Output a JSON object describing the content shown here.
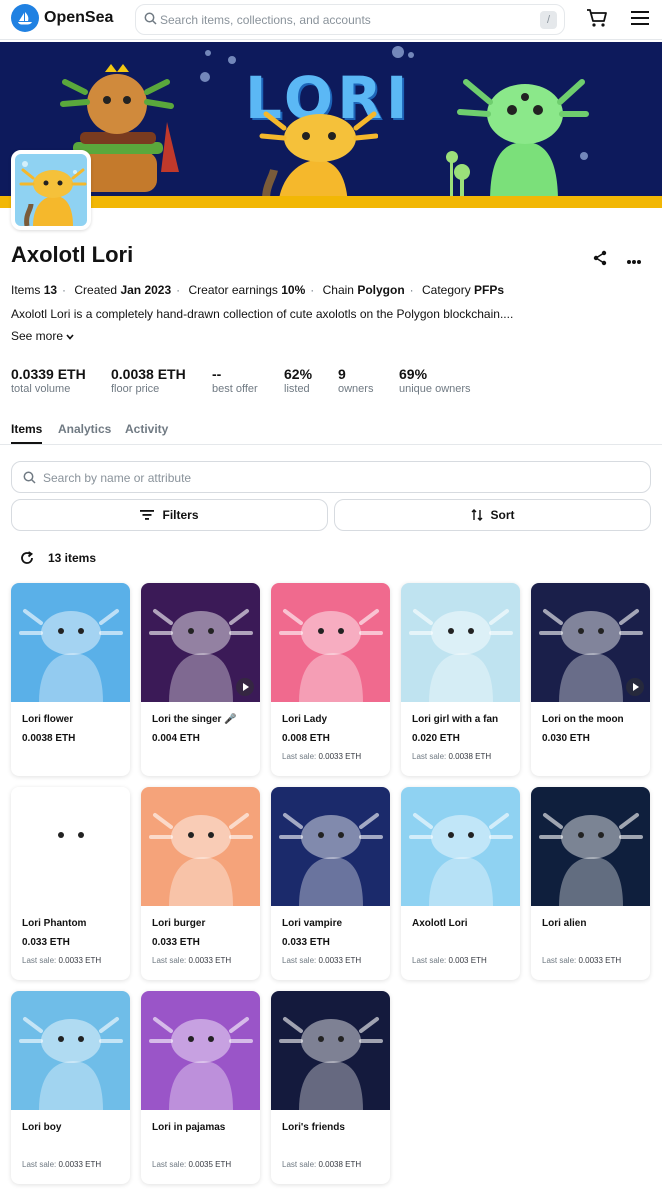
{
  "header": {
    "brand": "OpenSea",
    "search_placeholder": "Search items, collections, and accounts",
    "search_shortcut": "/",
    "icons": [
      "opensea-logo-icon",
      "search-icon",
      "cart-icon",
      "menu-icon"
    ]
  },
  "banner": {
    "title": "LORI"
  },
  "collection": {
    "title": "Axolotl Lori",
    "meta": {
      "items_label": "Items",
      "items_value": "13",
      "created_label": "Created",
      "created_value": "Jan 2023",
      "earnings_label": "Creator earnings",
      "earnings_value": "10%",
      "chain_label": "Chain",
      "chain_value": "Polygon",
      "category_label": "Category",
      "category_value": "PFPs"
    },
    "description": "Axolotl Lori is a completely hand-drawn collection of cute axolotls on the Polygon blockchain....",
    "see_more": "See more"
  },
  "stats": [
    {
      "value": "0.0339 ETH",
      "label": "total volume"
    },
    {
      "value": "0.0038 ETH",
      "label": "floor price"
    },
    {
      "value": "--",
      "label": "best offer"
    },
    {
      "value": "62%",
      "label": "listed"
    },
    {
      "value": "9",
      "label": "owners"
    },
    {
      "value": "69%",
      "label": "unique owners"
    }
  ],
  "tabs": [
    {
      "label": "Items",
      "active": true
    },
    {
      "label": "Analytics",
      "active": false
    },
    {
      "label": "Activity",
      "active": false
    }
  ],
  "filters": {
    "search_placeholder": "Search by name or attribute",
    "filters_label": "Filters",
    "sort_label": "Sort",
    "count": "13 items"
  },
  "colors": {
    "accent": "#2081e2",
    "banner_bg": "#0d1a5c",
    "banner_floor": "#f2b705"
  },
  "items": [
    {
      "name": "Lori flower",
      "price": "0.0038 ETH",
      "last_sale_label": "",
      "last_sale_value": "",
      "bg": "#5ab0e8",
      "video": false
    },
    {
      "name": "Lori the singer 🎤",
      "price": "0.004 ETH",
      "last_sale_label": "",
      "last_sale_value": "",
      "bg": "#3b1a57",
      "video": true
    },
    {
      "name": "Lori Lady",
      "price": "0.008 ETH",
      "last_sale_label": "Last sale:",
      "last_sale_value": "0.0033 ETH",
      "bg": "#f06a8e",
      "video": false
    },
    {
      "name": "Lori girl with a fan",
      "price": "0.020 ETH",
      "last_sale_label": "Last sale:",
      "last_sale_value": "0.0038 ETH",
      "bg": "#bfe3f0",
      "video": false
    },
    {
      "name": "Lori on the moon",
      "price": "0.030 ETH",
      "last_sale_label": "",
      "last_sale_value": "",
      "bg": "#1a1f4a",
      "video": true
    },
    {
      "name": "Lori Phantom",
      "price": "0.033 ETH",
      "last_sale_label": "Last sale:",
      "last_sale_value": "0.0033 ETH",
      "bg": "#ffffff",
      "video": false
    },
    {
      "name": "Lori burger",
      "price": "0.033 ETH",
      "last_sale_label": "Last sale:",
      "last_sale_value": "0.0033 ETH",
      "bg": "#f5a37a",
      "video": false
    },
    {
      "name": "Lori vampire",
      "price": "0.033 ETH",
      "last_sale_label": "Last sale:",
      "last_sale_value": "0.0033 ETH",
      "bg": "#1b2a6b",
      "video": false
    },
    {
      "name": "Axolotl Lori",
      "price": "",
      "last_sale_label": "Last sale:",
      "last_sale_value": "0.003 ETH",
      "bg": "#8fd2f2",
      "video": false
    },
    {
      "name": "Lori alien",
      "price": "",
      "last_sale_label": "Last sale:",
      "last_sale_value": "0.0033 ETH",
      "bg": "#0f1f3d",
      "video": false
    },
    {
      "name": "Lori boy",
      "price": "",
      "last_sale_label": "Last sale:",
      "last_sale_value": "0.0033 ETH",
      "bg": "#6fbde8",
      "video": false
    },
    {
      "name": "Lori in pajamas",
      "price": "",
      "last_sale_label": "Last sale:",
      "last_sale_value": "0.0035 ETH",
      "bg": "#9a55c8",
      "video": false
    },
    {
      "name": "Lori's friends",
      "price": "",
      "last_sale_label": "Last sale:",
      "last_sale_value": "0.0038 ETH",
      "bg": "#141a3d",
      "video": false
    }
  ]
}
